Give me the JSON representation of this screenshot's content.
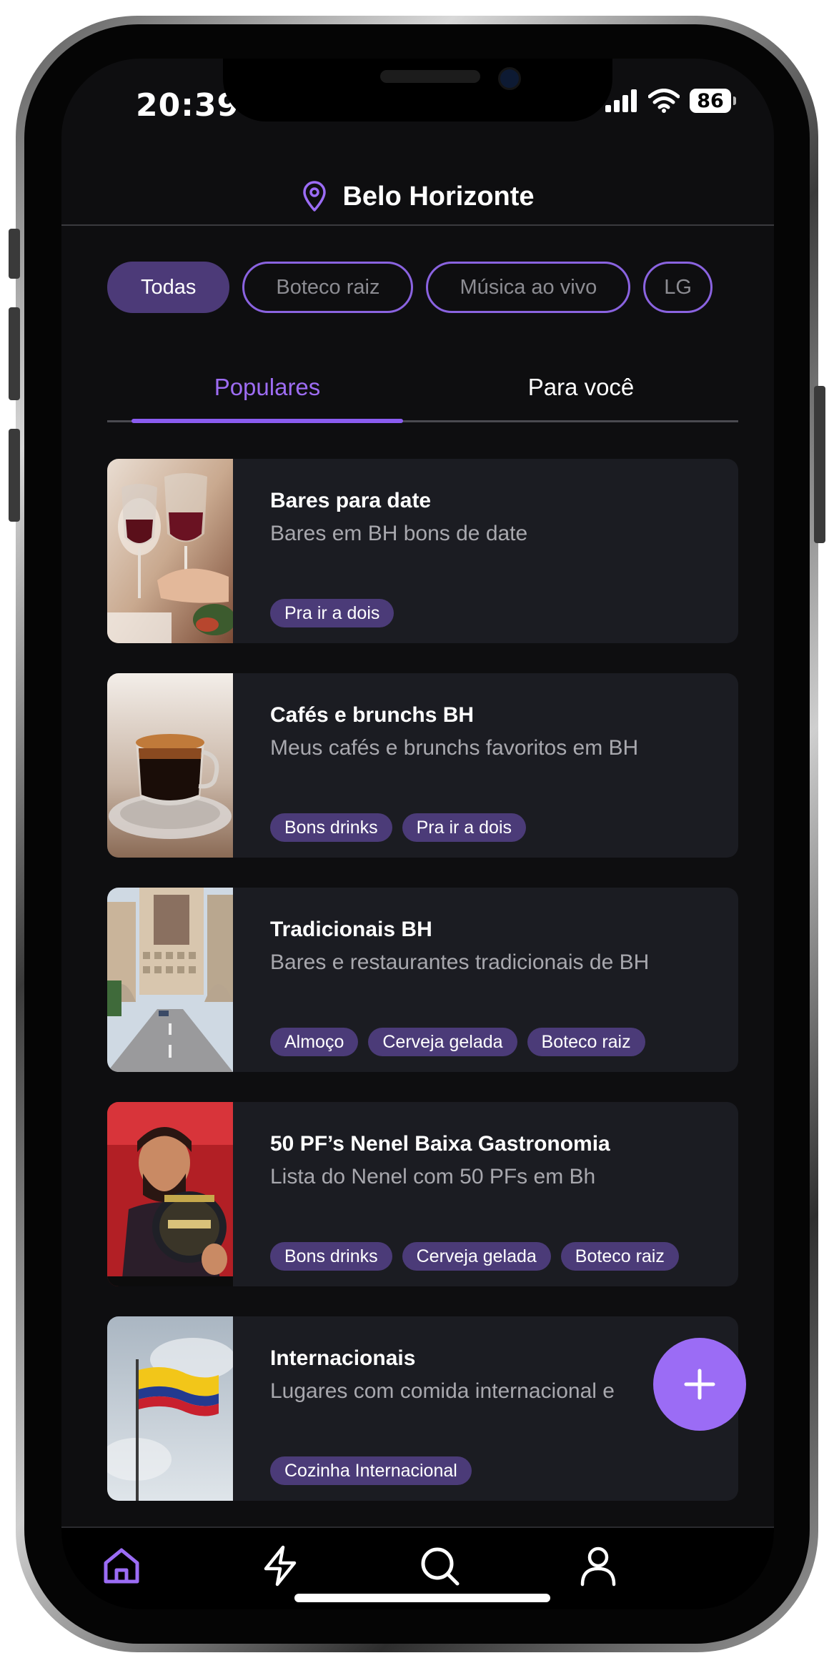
{
  "status_bar": {
    "time": "20:39",
    "battery": "86"
  },
  "header": {
    "city": "Belo Horizonte",
    "location_icon": "map-pin-icon"
  },
  "chips": [
    {
      "label": "Todas",
      "active": true
    },
    {
      "label": "Boteco raiz",
      "active": false
    },
    {
      "label": "Música ao vivo",
      "active": false
    },
    {
      "label": "LG",
      "active": false
    }
  ],
  "tabs": {
    "popular": "Populares",
    "for_you": "Para você"
  },
  "lists": [
    {
      "title": "Bares para date",
      "description": "Bares em BH bons de date",
      "tags": [
        "Pra ir a dois"
      ]
    },
    {
      "title": "Cafés e brunchs BH",
      "description": "Meus cafés e brunchs favoritos em BH",
      "tags": [
        "Bons drinks",
        "Pra ir a dois"
      ]
    },
    {
      "title": "Tradicionais BH",
      "description": "Bares e restaurantes tradicionais de BH",
      "tags": [
        "Almoço",
        "Cerveja gelada",
        "Boteco raiz"
      ]
    },
    {
      "title": "50 PF’s Nenel Baixa Gastronomia",
      "description": "Lista do Nenel com 50 PFs em Bh",
      "tags": [
        "Bons drinks",
        "Cerveja gelada",
        "Boteco raiz"
      ]
    },
    {
      "title": "Internacionais",
      "description": "Lugares com comida internacional e",
      "tags": [
        "Cozinha Internacional"
      ]
    }
  ],
  "fab": {
    "icon": "plus-icon"
  },
  "bottom_nav": [
    {
      "icon": "home-icon",
      "active": true
    },
    {
      "icon": "lightning-icon",
      "active": false
    },
    {
      "icon": "search-icon",
      "active": false
    },
    {
      "icon": "user-icon",
      "active": false
    }
  ],
  "colors": {
    "accent": "#9b6cf5",
    "tag_bg": "#4b3b78",
    "card_bg": "#1b1c22",
    "screen_bg": "#0e0e10"
  }
}
